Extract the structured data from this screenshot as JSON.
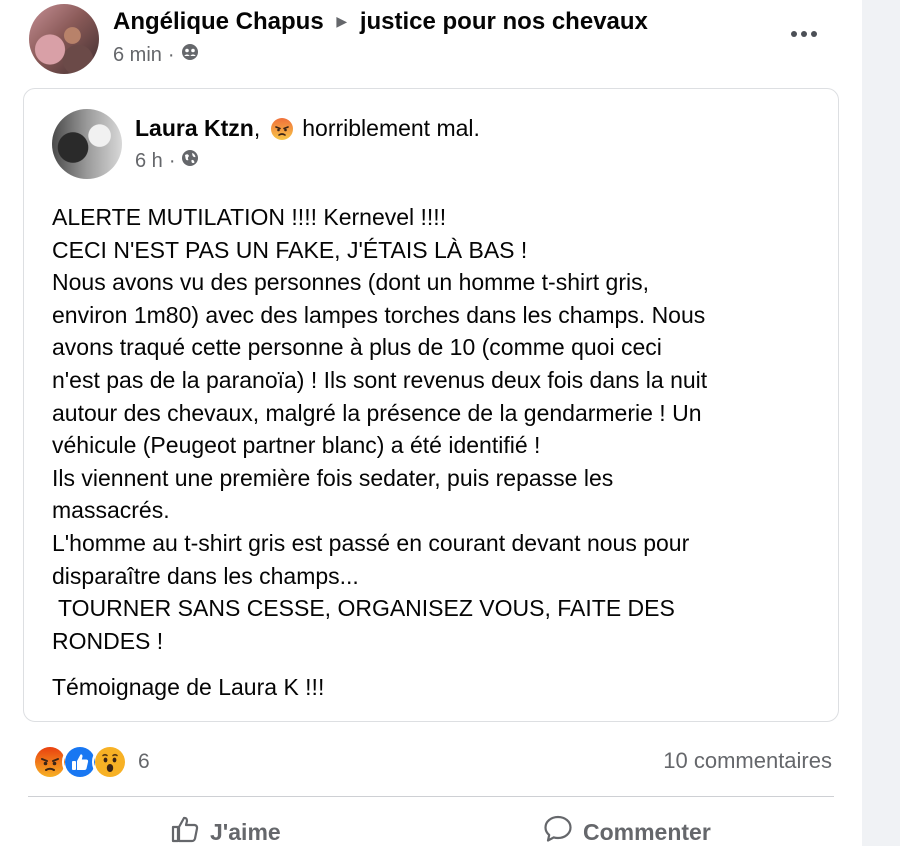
{
  "post": {
    "author": "Angélique Chapus",
    "group": "justice pour nos chevaux",
    "time": "6 min",
    "separator": "·",
    "audience_icon": "group-icon",
    "more_icon": "more-options-icon"
  },
  "shared_post": {
    "author": "Laura Ktzn",
    "feeling_emoji": "angry-face-icon",
    "feeling_text": "horriblement mal.",
    "time": "6 h",
    "separator": "·",
    "audience_icon": "globe-icon",
    "lines": [
      "ALERTE MUTILATION !!!! Kernevel !!!!",
      "CECI N'EST PAS UN FAKE, J'ÉTAIS LÀ BAS !",
      "Nous avons vu des personnes (dont un homme t-shirt gris,",
      "environ 1m80) avec des lampes torches dans les champs. Nous",
      "avons traqué cette personne à plus de 10 (comme quoi ceci",
      "n'est pas de la paranoïa) ! Ils sont revenus deux fois dans la nuit",
      "autour des chevaux, malgré la présence de la gendarmerie ! Un",
      "véhicule (Peugeot partner blanc) a été identifié !",
      "Ils viennent une première fois sedater, puis repasse les",
      "massacrés.",
      "L'homme au t-shirt gris est passé en courant devant nous pour",
      "disparaître dans les champs...",
      " TOURNER SANS CESSE, ORGANISEZ VOUS, FAITE DES",
      "RONDES !"
    ],
    "signature": "Témoignage de Laura K !!!"
  },
  "reactions": {
    "icons": [
      "angry-reaction-icon",
      "like-reaction-icon",
      "wow-reaction-icon"
    ],
    "count": "6",
    "comments": "10 commentaires"
  },
  "actions": {
    "like_label": "J'aime",
    "comment_label": "Commenter"
  },
  "colors": {
    "text": "#050505",
    "secondary": "#65676b",
    "like_blue": "#1877f2",
    "reaction_orange": "#f7b125",
    "angry_red": "#e9710f",
    "border": "#dddfe2"
  }
}
